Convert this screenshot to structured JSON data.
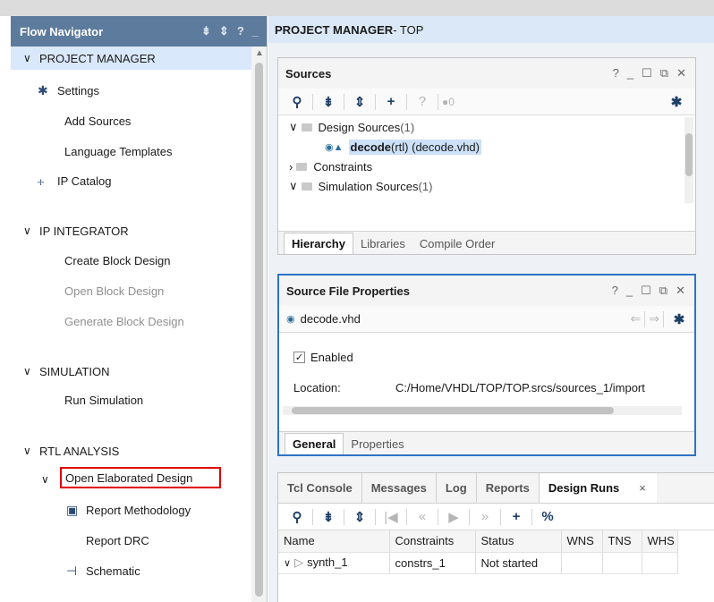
{
  "flow_navigator": {
    "title": "Flow Navigator",
    "tools": [
      "⇟",
      "⇕",
      "?",
      "_"
    ],
    "sections": [
      {
        "label": "PROJECT MANAGER",
        "items": [
          {
            "label": "Settings",
            "icon": "gear-icon",
            "glyph": "✱"
          },
          {
            "label": "Add Sources"
          },
          {
            "label": "Language Templates"
          },
          {
            "label": "IP Catalog",
            "icon": "ip-catalog-icon",
            "glyph": "⧾"
          }
        ]
      },
      {
        "label": "IP INTEGRATOR",
        "items": [
          {
            "label": "Create Block Design"
          },
          {
            "label": "Open Block Design",
            "disabled": true
          },
          {
            "label": "Generate Block Design",
            "disabled": true
          }
        ]
      },
      {
        "label": "SIMULATION",
        "items": [
          {
            "label": "Run Simulation"
          }
        ]
      },
      {
        "label": "RTL ANALYSIS",
        "items": [
          {
            "label": "Open Elaborated Design",
            "highlighted": true
          },
          {
            "label": "Report Methodology",
            "icon": "clipboard-icon",
            "glyph": "▣"
          },
          {
            "label": "Report DRC"
          },
          {
            "label": "Schematic",
            "icon": "schematic-icon",
            "glyph": "⊣"
          }
        ]
      }
    ]
  },
  "project_manager": {
    "title_bold": "PROJECT MANAGER",
    "title_rest": " - TOP"
  },
  "sources": {
    "title": "Sources",
    "window_tools": [
      "?",
      "_",
      "☐",
      "⧉",
      "✕"
    ],
    "warning_count": "0",
    "tree": [
      {
        "label": "Design Sources",
        "count": " (1)"
      },
      {
        "label_bold": "decode",
        "label_rest": "(rtl) (decode.vhd)"
      },
      {
        "label": "Constraints"
      },
      {
        "label": "Simulation Sources",
        "count": " (1)"
      }
    ],
    "tabs": [
      "Hierarchy",
      "Libraries",
      "Compile Order"
    ]
  },
  "source_file_properties": {
    "title": "Source File Properties",
    "window_tools": [
      "?",
      "_",
      "☐",
      "⧉",
      "✕"
    ],
    "file": "decode.vhd",
    "enabled_label": "Enabled",
    "location_label": "Location:",
    "location_value": "C:/Home/VHDL/TOP/TOP.srcs/sources_1/import",
    "tabs": [
      "General",
      "Properties"
    ]
  },
  "bottom_panel": {
    "tabs": [
      "Tcl Console",
      "Messages",
      "Log",
      "Reports",
      "Design Runs"
    ],
    "close": "×",
    "columns": [
      "Name",
      "Constraints",
      "Status",
      "WNS",
      "TNS",
      "WHS"
    ],
    "rows": [
      {
        "name": "synth_1",
        "constraints": "constrs_1",
        "status": "Not started",
        "wns": "",
        "tns": "",
        "whs": ""
      }
    ]
  }
}
